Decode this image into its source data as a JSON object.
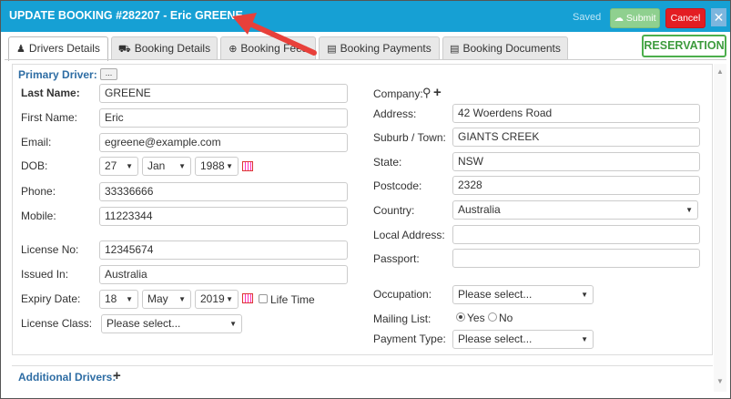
{
  "header": {
    "title": "UPDATE BOOKING #282207 - Eric GREENE",
    "saved": "Saved",
    "submit": "Submit",
    "cancel": "Cancel",
    "close": "✕"
  },
  "tabs": [
    {
      "label": "Drivers Details",
      "icon": "user-icon"
    },
    {
      "label": "Booking Details",
      "icon": "car-icon"
    },
    {
      "label": "Booking Fees",
      "icon": "plus-circle-icon"
    },
    {
      "label": "Booking Payments",
      "icon": "credit-card-icon"
    },
    {
      "label": "Booking Documents",
      "icon": "document-icon"
    }
  ],
  "reservation_button": "RESERVATION",
  "primary_driver": {
    "title": "Primary Driver:",
    "dots": "...",
    "last_name": {
      "label": "Last Name:",
      "value": "GREENE"
    },
    "first_name": {
      "label": "First Name:",
      "value": "Eric"
    },
    "email": {
      "label": "Email:",
      "value": "egreene@example.com"
    },
    "dob": {
      "label": "DOB:",
      "day": "27",
      "month": "Jan",
      "year": "1988"
    },
    "phone": {
      "label": "Phone:",
      "value": "33336666"
    },
    "mobile": {
      "label": "Mobile:",
      "value": "11223344"
    },
    "license_no": {
      "label": "License No:",
      "value": "12345674"
    },
    "issued_in": {
      "label": "Issued In:",
      "value": "Australia"
    },
    "expiry": {
      "label": "Expiry Date:",
      "day": "18",
      "month": "May",
      "year": "2019",
      "life_time": "Life Time"
    },
    "license_class": {
      "label": "License Class:",
      "value": "Please select..."
    }
  },
  "address": {
    "company": {
      "label": "Company:"
    },
    "address": {
      "label": "Address:",
      "value": "42 Woerdens Road"
    },
    "suburb": {
      "label": "Suburb / Town:",
      "value": "GIANTS CREEK"
    },
    "state": {
      "label": "State:",
      "value": "NSW"
    },
    "postcode": {
      "label": "Postcode:",
      "value": "2328"
    },
    "country": {
      "label": "Country:",
      "value": "Australia"
    },
    "local_address": {
      "label": "Local Address:",
      "value": ""
    },
    "passport": {
      "label": "Passport:",
      "value": ""
    },
    "occupation": {
      "label": "Occupation:",
      "value": "Please select..."
    },
    "mailing_list": {
      "label": "Mailing List:",
      "yes": "Yes",
      "no": "No",
      "selected": "Yes"
    },
    "payment_type": {
      "label": "Payment Type:",
      "value": "Please select..."
    }
  },
  "additional_drivers": {
    "title": "Additional Drivers:"
  },
  "colors": {
    "header": "#16a0d4",
    "submit": "#8fd08f",
    "cancel": "#e31d22",
    "reservation": "#4cae4c",
    "arrow": "#e8403a"
  }
}
